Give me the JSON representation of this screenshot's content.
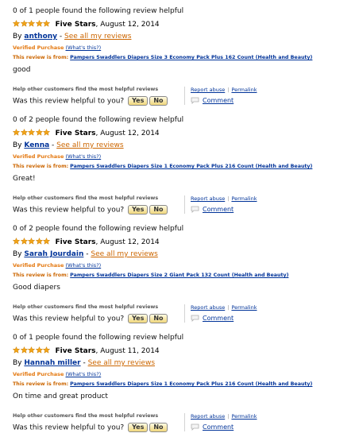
{
  "reviews": [
    {
      "helpful_count": "0 of 1 people found the following review helpful",
      "title": "Five Stars",
      "date": ", August 12, 2014",
      "author": "anthony",
      "see_all": "See all my reviews",
      "verified": "Verified Purchase",
      "whats_this": "(What's this?)",
      "from_label": "This review is from:",
      "product": "Pampers Swaddlers Diapers Size 3 Economy Pack Plus 162 Count (Health and Beauty)",
      "body": "good",
      "rating": 5
    },
    {
      "helpful_count": "0 of 2 people found the following review helpful",
      "title": "Five Stars",
      "date": ", August 12, 2014",
      "author": "Kenna",
      "see_all": "See all my reviews",
      "verified": "Verified Purchase",
      "whats_this": "(What's this?)",
      "from_label": "This review is from:",
      "product": "Pampers Swaddlers Diapers Size 1 Economy Pack Plus 216 Count (Health and Beauty)",
      "body": "Great!",
      "rating": 5
    },
    {
      "helpful_count": "0 of 2 people found the following review helpful",
      "title": "Five Stars",
      "date": ", August 12, 2014",
      "author": "Sarah Jourdain",
      "see_all": "See all my reviews",
      "verified": "Verified Purchase",
      "whats_this": "(What's this?)",
      "from_label": "This review is from:",
      "product": "Pampers Swaddlers Diapers Size 2 Giant Pack 132 Count (Health and Beauty)",
      "body": "Good diapers",
      "rating": 5
    },
    {
      "helpful_count": "0 of 1 people found the following review helpful",
      "title": "Five Stars",
      "date": ", August 11, 2014",
      "author": "Hannah miller",
      "see_all": "See all my reviews",
      "verified": "Verified Purchase",
      "whats_this": "(What's this?)",
      "from_label": "This review is from:",
      "product": "Pampers Swaddlers Diapers Size 1 Economy Pack Plus 216 Count (Health and Beauty)",
      "body": "On time and great product",
      "rating": 5
    }
  ],
  "common": {
    "separator": " - ",
    "help_other": "Help other customers find the most helpful reviews",
    "was_helpful": "Was this review helpful to you?",
    "yes": "Yes",
    "no": "No",
    "report_abuse": "Report abuse",
    "link_separator": "|",
    "permalink": "Permalink",
    "comment": "Comment"
  },
  "colors": {
    "star": "#f2a316",
    "link_blue": "#003399",
    "orange": "#cc6600"
  },
  "icons": {
    "star": "star-icon",
    "comment": "comment-bubble-icon"
  }
}
